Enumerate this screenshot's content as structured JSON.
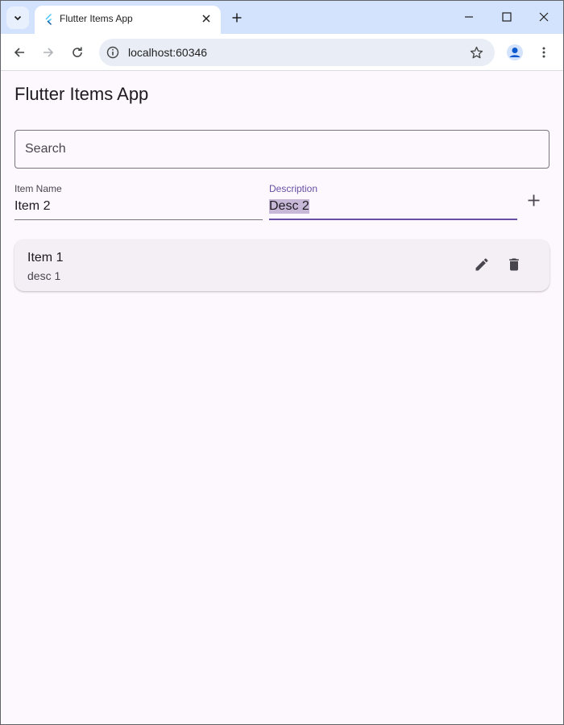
{
  "browser": {
    "tab_title": "Flutter Items App",
    "url": "localhost:60346"
  },
  "app": {
    "title": "Flutter Items App",
    "search": {
      "placeholder": "Search",
      "value": ""
    },
    "item_name_field": {
      "label": "Item Name",
      "value": "Item 2"
    },
    "description_field": {
      "label": "Description",
      "value": "Desc 2"
    },
    "items": [
      {
        "title": "Item 1",
        "subtitle": "desc 1"
      }
    ]
  },
  "colors": {
    "accent": "#6750a4",
    "tabstrip": "#d3e3fd",
    "background": "#fdf7fe",
    "card": "#f4eff4"
  },
  "icons": {
    "tab_list": "chevron-down-icon",
    "favicon": "flutter-logo-icon",
    "tab_close": "close-icon",
    "new_tab": "plus-icon",
    "minimize": "minimize-icon",
    "maximize": "maximize-icon",
    "close_window": "close-icon",
    "back": "arrow-left-icon",
    "forward": "arrow-right-icon",
    "reload": "reload-icon",
    "site_info": "info-icon",
    "bookmark": "star-icon",
    "profile": "profile-icon",
    "menu": "more-vert-icon",
    "add": "plus-icon",
    "edit": "pencil-icon",
    "delete": "trash-icon"
  }
}
